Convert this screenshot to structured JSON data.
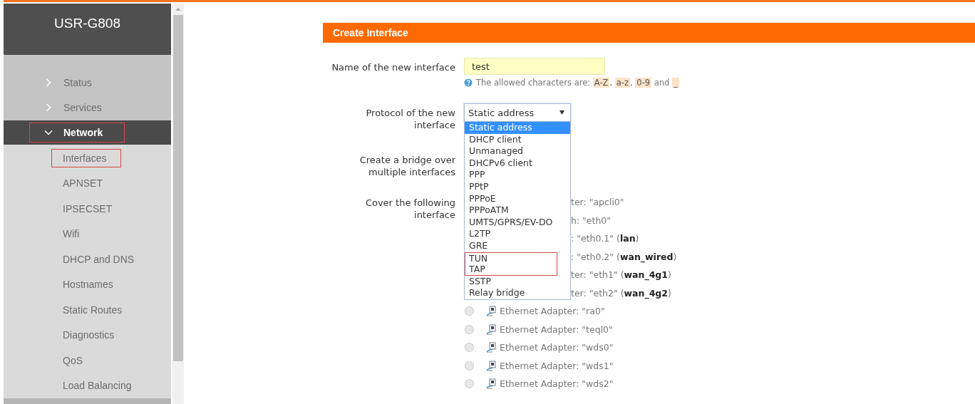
{
  "sidebar": {
    "title": "USR-G808",
    "items": [
      {
        "label": "Status",
        "expanded": false,
        "selected": false,
        "highlighted": false
      },
      {
        "label": "Services",
        "expanded": false,
        "selected": false,
        "highlighted": false
      },
      {
        "label": "Network",
        "expanded": true,
        "selected": true,
        "highlighted": true,
        "children": [
          {
            "label": "Interfaces",
            "highlighted": true
          },
          {
            "label": "APNSET",
            "highlighted": false
          },
          {
            "label": "IPSECSET",
            "highlighted": false
          },
          {
            "label": "Wifi",
            "highlighted": false
          },
          {
            "label": "DHCP and DNS",
            "highlighted": false
          },
          {
            "label": "Hostnames",
            "highlighted": false
          },
          {
            "label": "Static Routes",
            "highlighted": false
          },
          {
            "label": "Diagnostics",
            "highlighted": false
          },
          {
            "label": "QoS",
            "highlighted": false
          },
          {
            "label": "Load Balancing",
            "highlighted": false
          }
        ]
      }
    ]
  },
  "section": {
    "title": "Create Interface"
  },
  "form": {
    "name_field": {
      "label": "Name of the new interface",
      "value": "test",
      "hint": [
        {
          "kind": "text",
          "text": "The allowed characters are:"
        },
        {
          "kind": "code",
          "text": "A-Z"
        },
        {
          "kind": "text",
          "text": ","
        },
        {
          "kind": "code",
          "text": "a-z"
        },
        {
          "kind": "text",
          "text": ","
        },
        {
          "kind": "code",
          "text": "0-9"
        },
        {
          "kind": "text",
          "text": "and"
        },
        {
          "kind": "code",
          "text": "_"
        }
      ]
    },
    "protocol": {
      "label": "Protocol of the new interface",
      "value": "Static address",
      "expanded": true,
      "options": [
        {
          "label": "Static address",
          "selected": true,
          "highlighted": false
        },
        {
          "label": "DHCP client",
          "selected": false,
          "highlighted": false
        },
        {
          "label": "Unmanaged",
          "selected": false,
          "highlighted": false
        },
        {
          "label": "DHCPv6 client",
          "selected": false,
          "highlighted": false
        },
        {
          "label": "PPP",
          "selected": false,
          "highlighted": false
        },
        {
          "label": "PPtP",
          "selected": false,
          "highlighted": false
        },
        {
          "label": "PPPoE",
          "selected": false,
          "highlighted": false
        },
        {
          "label": "PPPoATM",
          "selected": false,
          "highlighted": false
        },
        {
          "label": "UMTS/GPRS/EV-DO",
          "selected": false,
          "highlighted": false
        },
        {
          "label": "L2TP",
          "selected": false,
          "highlighted": false
        },
        {
          "label": "GRE",
          "selected": false,
          "highlighted": false
        },
        {
          "label": "TUN",
          "selected": false,
          "highlighted": true
        },
        {
          "label": "TAP",
          "selected": false,
          "highlighted": true
        },
        {
          "label": "SSTP",
          "selected": false,
          "highlighted": false
        },
        {
          "label": "Relay bridge",
          "selected": false,
          "highlighted": false
        }
      ]
    },
    "bridge": {
      "label": "Create a bridge over multiple interfaces"
    },
    "cover": {
      "label": "Cover the following interface",
      "interfaces": [
        {
          "kind": "covered",
          "text": "ter: \"apcli0\""
        },
        {
          "kind": "covered",
          "text": "h: \"eth0\""
        },
        {
          "kind": "covered",
          "text": ": \"eth0.1\" (**lan**)"
        },
        {
          "kind": "covered",
          "text": ": \"eth0.2\" (**wan_wired**)"
        },
        {
          "kind": "covered",
          "text": "ter: \"eth1\" (**wan_4g1**)"
        },
        {
          "kind": "covered",
          "text": "ter: \"eth2\" (**wan_4g2**)"
        },
        {
          "kind": "adapter",
          "text": "Ethernet Adapter: \"ra0\"",
          "selected": false
        },
        {
          "kind": "adapter",
          "text": "Ethernet Adapter: \"teql0\"",
          "selected": false
        },
        {
          "kind": "adapter",
          "text": "Ethernet Adapter: \"wds0\"",
          "selected": false
        },
        {
          "kind": "adapter",
          "text": "Ethernet Adapter: \"wds1\"",
          "selected": false
        },
        {
          "kind": "adapter",
          "text": "Ethernet Adapter: \"wds2\"",
          "selected": false
        }
      ]
    }
  }
}
